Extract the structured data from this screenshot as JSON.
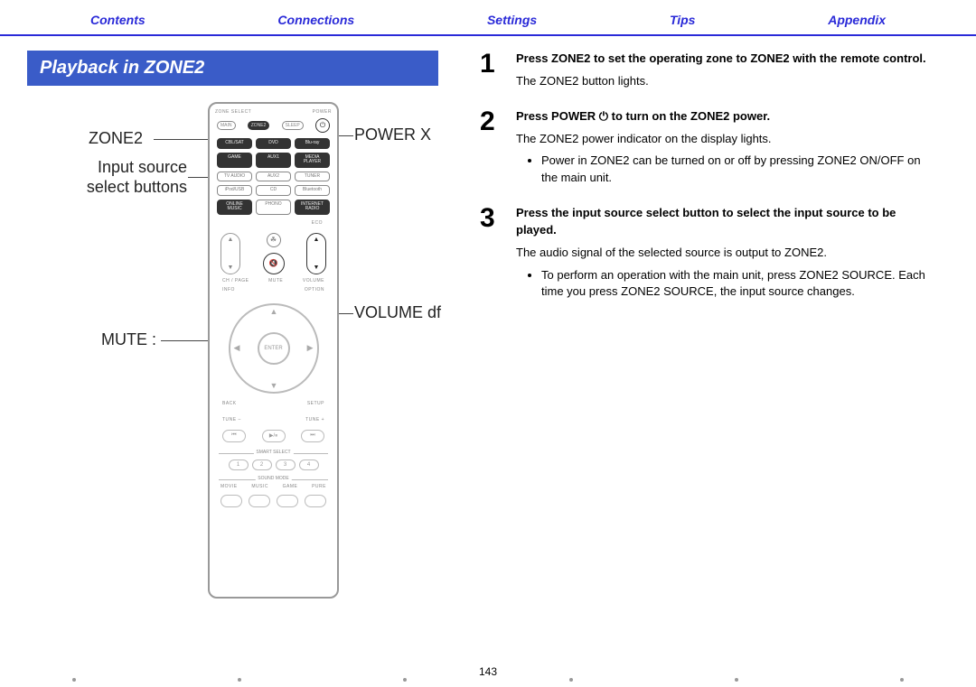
{
  "nav": {
    "contents": "Contents",
    "connections": "Connections",
    "settings": "Settings",
    "tips": "Tips",
    "appendix": "Appendix"
  },
  "section_title": "Playback in ZONE2",
  "callouts": {
    "zone2": "ZONE2",
    "input_source": "Input source\nselect buttons",
    "mute": "MUTE :",
    "power": "POWER X",
    "volume": "VOLUME df"
  },
  "remote": {
    "zone_select_label": "ZONE SELECT",
    "power_label": "POWER",
    "zone_main": "MAIN",
    "zone_zone2": "ZONE2",
    "sleep": "SLEEP",
    "power_icon": "⏻",
    "sources": [
      {
        "label": "CBL/SAT",
        "dark": true
      },
      {
        "label": "DVD",
        "dark": true
      },
      {
        "label": "Blu-ray",
        "dark": true
      },
      {
        "label": "GAME",
        "dark": true
      },
      {
        "label": "AUX1",
        "dark": true
      },
      {
        "label": "MEDIA PLAYER",
        "dark": true
      },
      {
        "label": "TV AUDIO",
        "dark": false
      },
      {
        "label": "AUX2",
        "dark": false
      },
      {
        "label": "TUNER",
        "dark": false
      },
      {
        "label": "iPod/USB",
        "dark": false
      },
      {
        "label": "CD",
        "dark": false
      },
      {
        "label": "Bluetooth",
        "dark": false
      },
      {
        "label": "ONLINE MUSIC",
        "dark": true
      },
      {
        "label": "PHONO",
        "dark": false
      },
      {
        "label": "INTERNET RADIO",
        "dark": true
      }
    ],
    "eco": "ECO",
    "ch_page": "CH / PAGE",
    "mute_lbl": "MUTE",
    "volume_lbl": "VOLUME",
    "mute_icon": "🔇",
    "info": "INFO",
    "option": "OPTION",
    "enter": "ENTER",
    "back": "BACK",
    "setup": "SETUP",
    "tune_minus": "TUNE –",
    "tune_plus": "TUNE +",
    "transport": [
      "⏮",
      "▶/⏸",
      "⏭"
    ],
    "smart_select_label": "SMART SELECT",
    "smart": [
      "1",
      "2",
      "3",
      "4"
    ],
    "sound_mode_label": "SOUND MODE",
    "sound_labels": [
      "MOVIE",
      "MUSIC",
      "GAME",
      "PURE"
    ]
  },
  "steps": [
    {
      "num": "1",
      "bold": "Press ZONE2 to set the operating zone to ZONE2 with the remote control.",
      "lines": [
        "The ZONE2 button lights."
      ],
      "bullets": []
    },
    {
      "num": "2",
      "bold": "Press POWER ⏻ to turn on the ZONE2 power.",
      "lines": [
        "The ZONE2 power indicator on the display lights."
      ],
      "bullets": [
        "Power in ZONE2 can be turned on or off by pressing ZONE2 ON/OFF on the main unit."
      ]
    },
    {
      "num": "3",
      "bold": "Press the input source select button to select the input source to be played.",
      "lines": [
        "The audio signal of the selected source is output to ZONE2."
      ],
      "bullets": [
        "To perform an operation with the main unit, press ZONE2 SOURCE. Each time you press ZONE2 SOURCE, the input source changes."
      ]
    }
  ],
  "page_number": "143"
}
